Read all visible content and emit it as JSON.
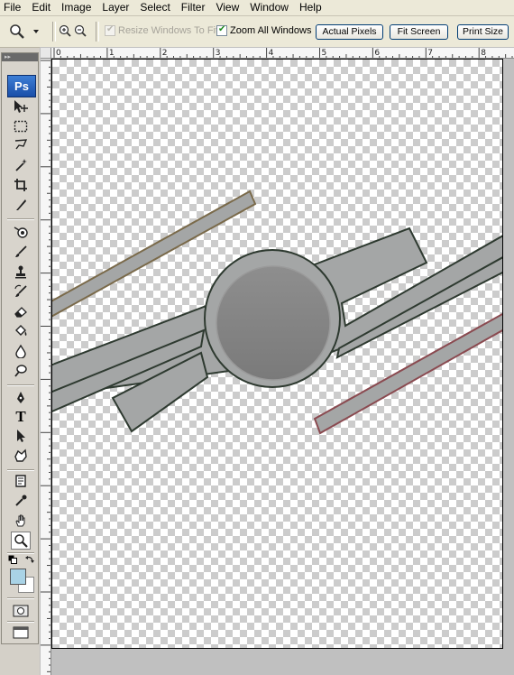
{
  "menu": [
    "File",
    "Edit",
    "Image",
    "Layer",
    "Select",
    "Filter",
    "View",
    "Window",
    "Help"
  ],
  "options": {
    "resize_windows_label": "Resize Windows To Fit",
    "resize_windows_checked": true,
    "resize_windows_enabled": false,
    "zoom_all_label": "Zoom All Windows",
    "zoom_all_checked": true,
    "actual_pixels_label": "Actual Pixels",
    "fit_screen_label": "Fit Screen",
    "print_size_label": "Print Size"
  },
  "toolbox": {
    "logo": "Ps",
    "active_tool": "zoom-tool",
    "tools": [
      "move-tool",
      "marquee-tool",
      "lasso-tool",
      "magic-wand-tool",
      "crop-tool",
      "slice-tool",
      "healing-brush-tool",
      "brush-tool",
      "clone-stamp-tool",
      "history-brush-tool",
      "eraser-tool",
      "paint-bucket-tool",
      "blur-tool",
      "dodge-tool",
      "pen-tool",
      "type-tool",
      "path-selection-tool",
      "custom-shape-tool",
      "notes-tool",
      "eyedropper-tool",
      "hand-tool",
      "zoom-tool"
    ],
    "type_tool_glyph": "T",
    "foreground_color": "#a9d3e6",
    "background_color": "#ffffff"
  },
  "rulers": {
    "horizontal": [
      "0",
      "1",
      "2",
      "3",
      "4",
      "5",
      "6",
      "7",
      "8"
    ]
  },
  "colors": {
    "chrome": "#d4d0c8",
    "menubar": "#ece9d8",
    "shape_fill": "#a4a6a6",
    "shape_stroke": "#2e3a30",
    "circle_fill": "#848484",
    "top_left_bar_stroke": "#7a6a4a",
    "bottom_right_bar_stroke": "#8a4a50"
  }
}
